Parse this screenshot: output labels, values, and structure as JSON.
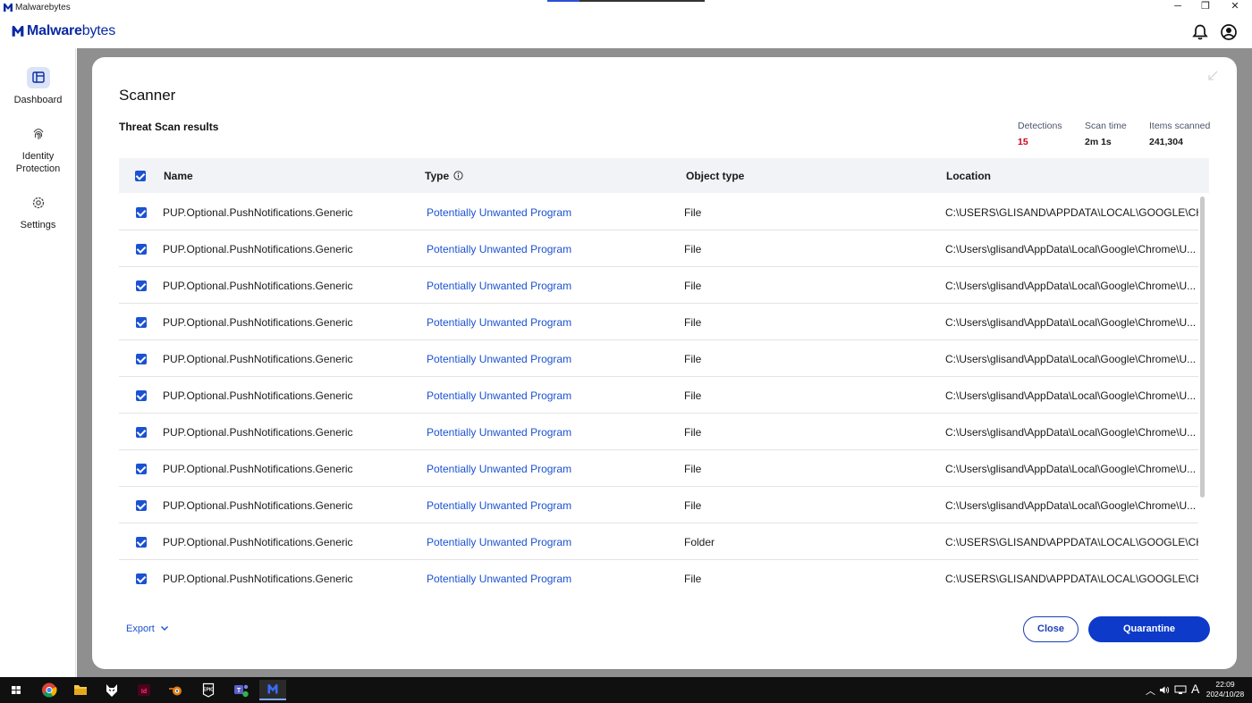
{
  "window": {
    "title": "Malwarebytes",
    "controls": {
      "minimize": "─",
      "restore": "❐",
      "close": "✕"
    }
  },
  "header": {
    "brand_bold": "Malware",
    "brand_thin": "bytes",
    "icons": [
      "bell-icon",
      "account-icon"
    ]
  },
  "sidebar": {
    "items": [
      {
        "label": "Dashboard",
        "icon": "dashboard-icon",
        "active": true
      },
      {
        "label": "Identity Protection",
        "icon": "fingerprint-icon",
        "active": false
      },
      {
        "label": "Settings",
        "icon": "gear-icon",
        "active": false
      }
    ]
  },
  "scanner": {
    "title": "Scanner",
    "results_title": "Threat Scan results",
    "stats": {
      "detections_label": "Detections",
      "detections_value": "15",
      "scan_time_label": "Scan time",
      "scan_time_value": "2m 1s",
      "items_scanned_label": "Items scanned",
      "items_scanned_value": "241,304"
    },
    "columns": [
      "Name",
      "Type",
      "Object type",
      "Location"
    ],
    "rows": [
      {
        "name": "PUP.Optional.PushNotifications.Generic",
        "type": "Potentially Unwanted Program",
        "object_type": "File",
        "location": "C:\\USERS\\GLISAND\\APPDATA\\LOCAL\\GOOGLE\\CH...",
        "checked": true
      },
      {
        "name": "PUP.Optional.PushNotifications.Generic",
        "type": "Potentially Unwanted Program",
        "object_type": "File",
        "location": "C:\\Users\\glisand\\AppData\\Local\\Google\\Chrome\\U...",
        "checked": true
      },
      {
        "name": "PUP.Optional.PushNotifications.Generic",
        "type": "Potentially Unwanted Program",
        "object_type": "File",
        "location": "C:\\Users\\glisand\\AppData\\Local\\Google\\Chrome\\U...",
        "checked": true
      },
      {
        "name": "PUP.Optional.PushNotifications.Generic",
        "type": "Potentially Unwanted Program",
        "object_type": "File",
        "location": "C:\\Users\\glisand\\AppData\\Local\\Google\\Chrome\\U...",
        "checked": true
      },
      {
        "name": "PUP.Optional.PushNotifications.Generic",
        "type": "Potentially Unwanted Program",
        "object_type": "File",
        "location": "C:\\Users\\glisand\\AppData\\Local\\Google\\Chrome\\U...",
        "checked": true
      },
      {
        "name": "PUP.Optional.PushNotifications.Generic",
        "type": "Potentially Unwanted Program",
        "object_type": "File",
        "location": "C:\\Users\\glisand\\AppData\\Local\\Google\\Chrome\\U...",
        "checked": true
      },
      {
        "name": "PUP.Optional.PushNotifications.Generic",
        "type": "Potentially Unwanted Program",
        "object_type": "File",
        "location": "C:\\Users\\glisand\\AppData\\Local\\Google\\Chrome\\U...",
        "checked": true
      },
      {
        "name": "PUP.Optional.PushNotifications.Generic",
        "type": "Potentially Unwanted Program",
        "object_type": "File",
        "location": "C:\\Users\\glisand\\AppData\\Local\\Google\\Chrome\\U...",
        "checked": true
      },
      {
        "name": "PUP.Optional.PushNotifications.Generic",
        "type": "Potentially Unwanted Program",
        "object_type": "File",
        "location": "C:\\Users\\glisand\\AppData\\Local\\Google\\Chrome\\U...",
        "checked": true
      },
      {
        "name": "PUP.Optional.PushNotifications.Generic",
        "type": "Potentially Unwanted Program",
        "object_type": "Folder",
        "location": "C:\\USERS\\GLISAND\\APPDATA\\LOCAL\\GOOGLE\\CH...",
        "checked": true
      },
      {
        "name": "PUP.Optional.PushNotifications.Generic",
        "type": "Potentially Unwanted Program",
        "object_type": "File",
        "location": "C:\\USERS\\GLISAND\\APPDATA\\LOCAL\\GOOGLE\\CH...",
        "checked": true
      }
    ],
    "export_label": "Export",
    "close_label": "Close",
    "quarantine_label": "Quarantine"
  },
  "taskbar": {
    "apps": [
      "windows-start-icon",
      "chrome-icon",
      "file-explorer-icon",
      "wolf-app-icon",
      "indesign-icon",
      "blender-icon",
      "epic-games-icon",
      "teams-icon",
      "malwarebytes-icon"
    ],
    "tray_ime": "A",
    "clock_time": "22:09",
    "clock_date": "2024/10/28"
  },
  "colors": {
    "brand": "#0a2aa3",
    "accent": "#1b52d1",
    "detections": "#d0021b",
    "quarantine_button": "#0d3ac9"
  }
}
